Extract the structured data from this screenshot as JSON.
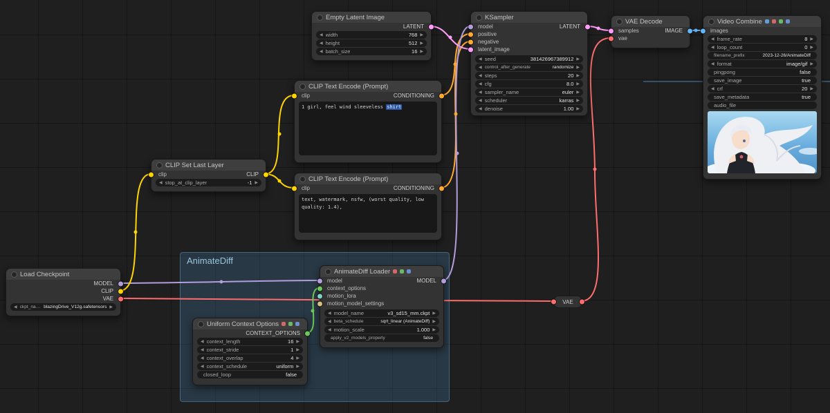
{
  "icons": {
    "left_arrow": "◀",
    "right_arrow": "▶"
  },
  "colors": {
    "MODEL": "#b39ddb",
    "CLIP": "#ffd500",
    "VAE": "#ff6e6e",
    "CONDITIONING": "#ffa931",
    "LATENT": "#ff9cf9",
    "IMAGE": "#64b5f6",
    "CONTEXT_OPTIONS": "#6ec95c",
    "group": "#3b6e92"
  },
  "group": {
    "title": "AnimateDiff"
  },
  "reroute": {
    "label": "VAE"
  },
  "nodes": {
    "load_checkpoint": {
      "title": "Load Checkpoint",
      "outputs": {
        "model": "MODEL",
        "clip": "CLIP",
        "vae": "VAE"
      },
      "widgets": {
        "ckpt_name": {
          "label": "ckpt_name",
          "value": "blazingDrive_V12g.safetensors"
        }
      }
    },
    "clip_set_last_layer": {
      "title": "CLIP Set Last Layer",
      "inputs": {
        "clip": "clip"
      },
      "outputs": {
        "clip": "CLIP"
      },
      "widgets": {
        "stop_at_clip_layer": {
          "label": "stop_at_clip_layer",
          "value": "-1"
        }
      }
    },
    "clip_text_positive": {
      "title": "CLIP Text Encode (Prompt)",
      "inputs": {
        "clip": "clip"
      },
      "outputs": {
        "conditioning": "CONDITIONING"
      },
      "prompt": {
        "text": "1 girl, feel wind sleeveless ",
        "highlight": "shirt"
      }
    },
    "clip_text_negative": {
      "title": "CLIP Text Encode (Prompt)",
      "inputs": {
        "clip": "clip"
      },
      "outputs": {
        "conditioning": "CONDITIONING"
      },
      "prompt": {
        "text": "text, watermark, nsfw, (worst quality, low quality: 1.4),"
      }
    },
    "empty_latent": {
      "title": "Empty Latent Image",
      "outputs": {
        "latent": "LATENT"
      },
      "widgets": {
        "width": {
          "label": "width",
          "value": "768"
        },
        "height": {
          "label": "height",
          "value": "512"
        },
        "batch_size": {
          "label": "batch_size",
          "value": "16"
        }
      }
    },
    "ksampler": {
      "title": "KSampler",
      "inputs": {
        "model": "model",
        "positive": "positive",
        "negative": "negative",
        "latent_image": "latent_image"
      },
      "outputs": {
        "latent": "LATENT"
      },
      "widgets": {
        "seed": {
          "label": "seed",
          "value": "381426967389912"
        },
        "control_after_generate": {
          "label": "control_after_generate",
          "value": "randomize"
        },
        "steps": {
          "label": "steps",
          "value": "20"
        },
        "cfg": {
          "label": "cfg",
          "value": "8.0"
        },
        "sampler_name": {
          "label": "sampler_name",
          "value": "euler"
        },
        "scheduler": {
          "label": "scheduler",
          "value": "karras"
        },
        "denoise": {
          "label": "denoise",
          "value": "1.00"
        }
      }
    },
    "vae_decode": {
      "title": "VAE Decode",
      "inputs": {
        "samples": "samples",
        "vae": "vae"
      },
      "outputs": {
        "image": "IMAGE"
      }
    },
    "video_combine": {
      "title": "Video Combine",
      "inputs": {
        "images": "images"
      },
      "widgets": {
        "frame_rate": {
          "label": "frame_rate",
          "value": "8"
        },
        "loop_count": {
          "label": "loop_count",
          "value": "0"
        },
        "filename_prefix": {
          "label": "filename_prefix",
          "value": "2023-12-26/AnimateDiff"
        },
        "format": {
          "label": "format",
          "value": "image/gif"
        },
        "pingpong": {
          "label": "pingpong",
          "value": "false"
        },
        "save_image": {
          "label": "save_image",
          "value": "true"
        },
        "crf": {
          "label": "crf",
          "value": "20"
        },
        "save_metadata": {
          "label": "save_metadata",
          "value": "true"
        },
        "audio_file": {
          "label": "audio_file",
          "value": ""
        }
      }
    },
    "animatediff_loader": {
      "title": "AnimateDiff Loader",
      "inputs": {
        "model": "model",
        "context_options": "context_options",
        "motion_lora": "motion_lora",
        "motion_model_settings": "motion_model_settings"
      },
      "outputs": {
        "model": "MODEL"
      },
      "widgets": {
        "model_name": {
          "label": "model_name",
          "value": "v3_sd15_mm.ckpt"
        },
        "beta_schedule": {
          "label": "beta_schedule",
          "value": "sqrt_linear (AnimateDiff)"
        },
        "motion_scale": {
          "label": "motion_scale",
          "value": "1.000"
        },
        "apply_v2_models_properly": {
          "label": "apply_v2_models_properly",
          "value": "false"
        }
      }
    },
    "uniform_context_options": {
      "title": "Uniform Context Options",
      "outputs": {
        "context_options": "CONTEXT_OPTIONS"
      },
      "widgets": {
        "context_length": {
          "label": "context_length",
          "value": "16"
        },
        "context_stride": {
          "label": "context_stride",
          "value": "1"
        },
        "context_overlap": {
          "label": "context_overlap",
          "value": "4"
        },
        "context_schedule": {
          "label": "context_schedule",
          "value": "uniform"
        },
        "closed_loop": {
          "label": "closed_loop",
          "value": "false"
        }
      }
    }
  }
}
